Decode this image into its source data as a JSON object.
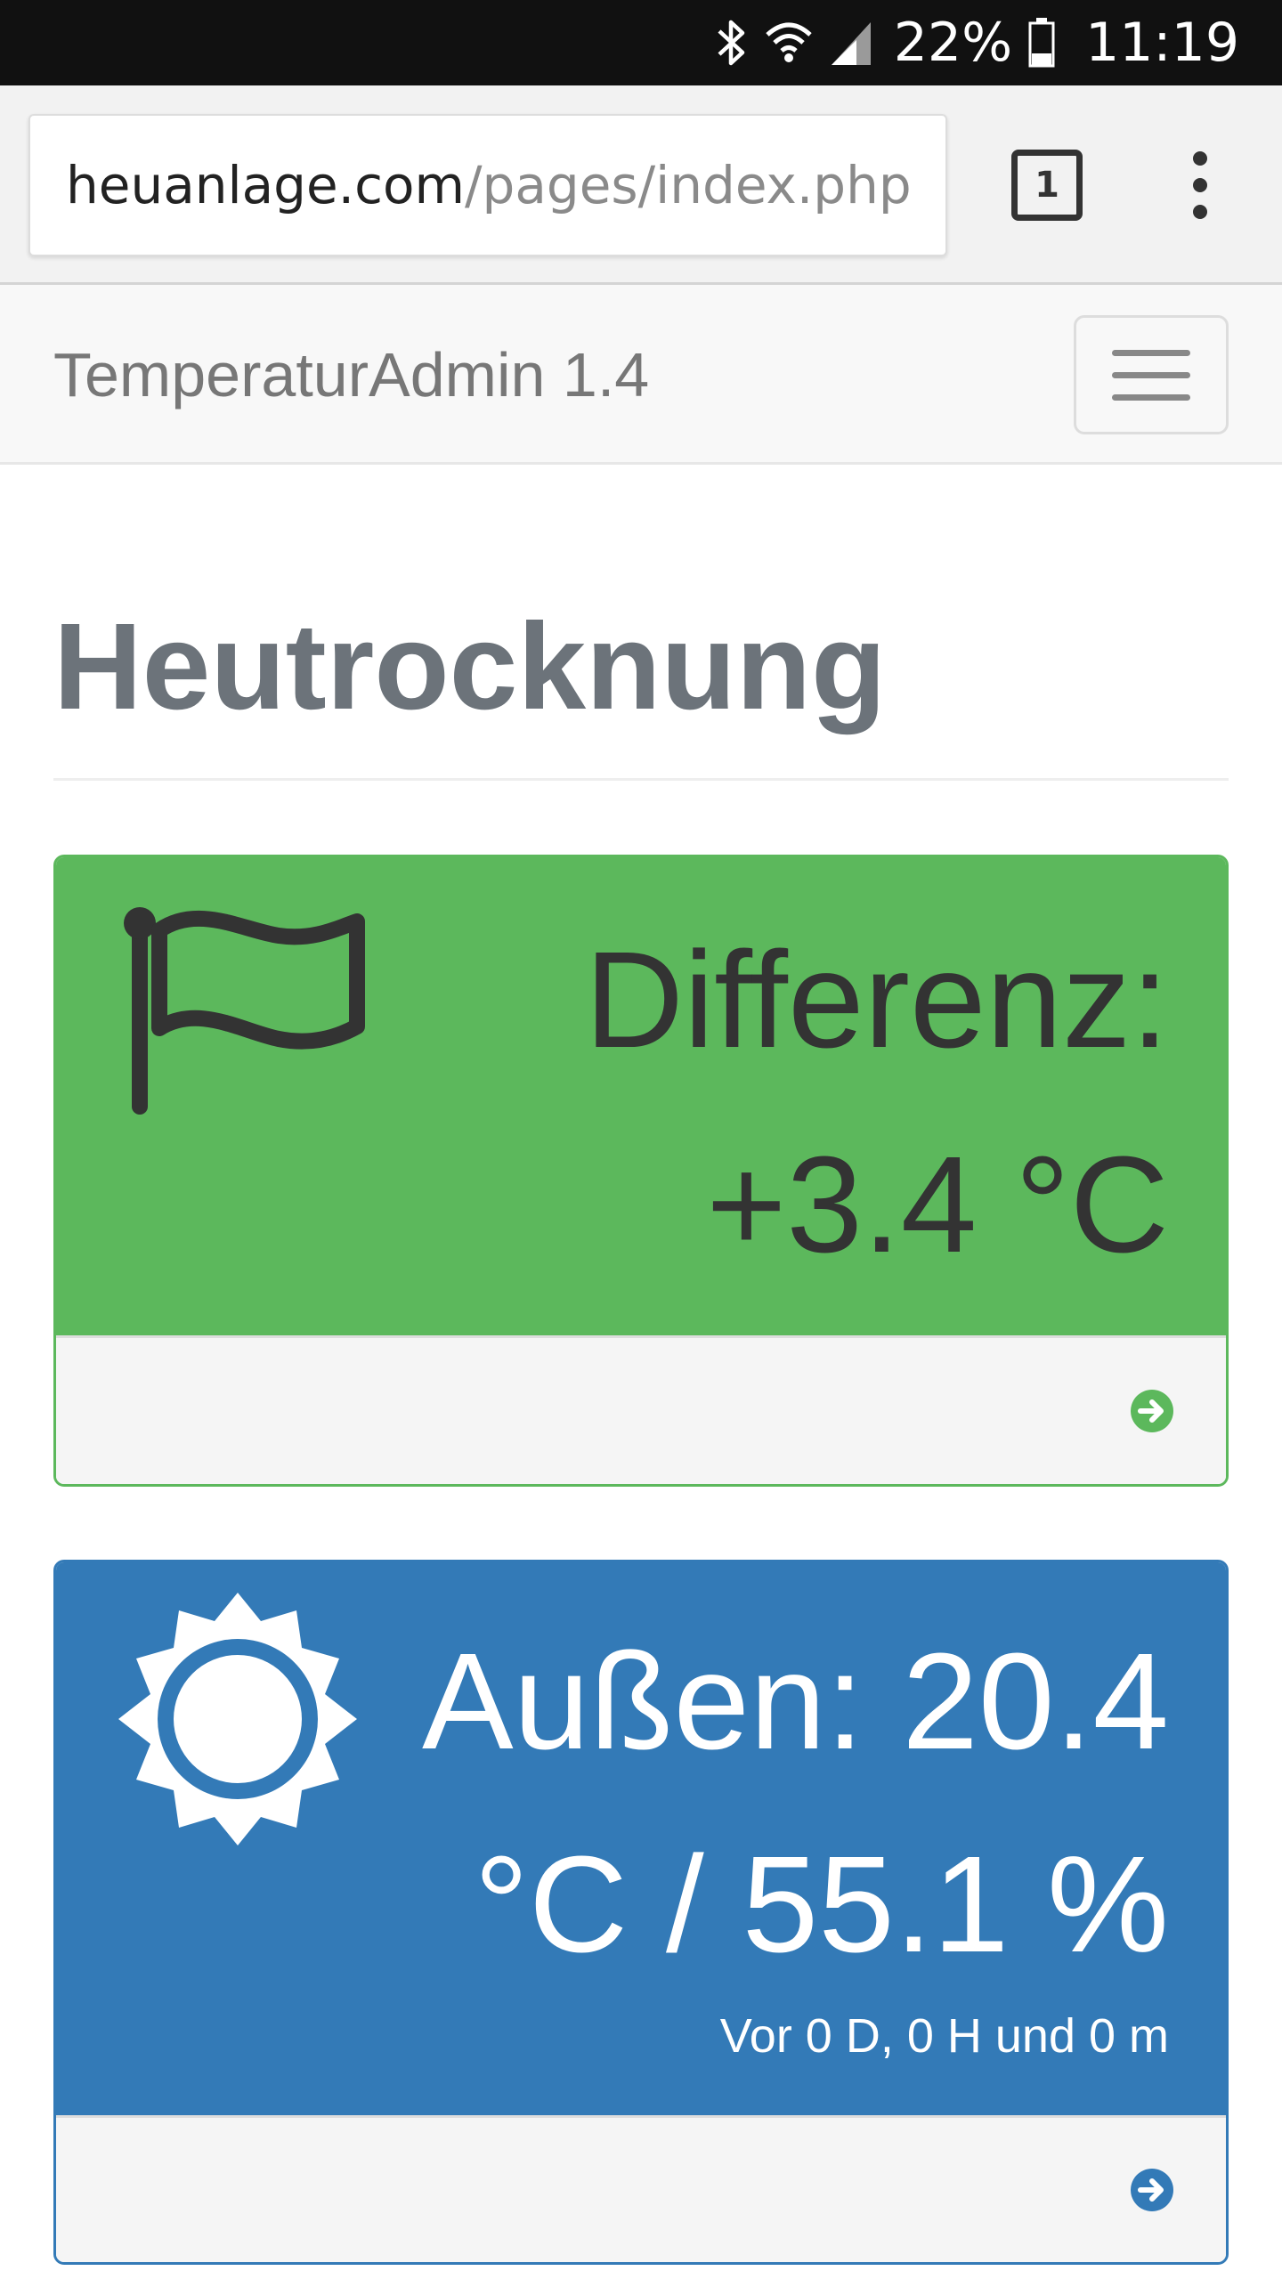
{
  "status_bar": {
    "battery": "22%",
    "time": "11:19",
    "icons": [
      "bluetooth-icon",
      "wifi-icon",
      "signal-icon",
      "battery-icon"
    ]
  },
  "browser": {
    "url_host": "heuanlage.com",
    "url_path": "/pages/index.php",
    "tab_count": "1"
  },
  "navbar": {
    "brand": "TemperaturAdmin 1.4"
  },
  "page": {
    "title": "Heutrocknung"
  },
  "panels": [
    {
      "icon": "flag-icon",
      "line1": "Differenz:",
      "line2": "+3.4 °C",
      "color": "#5cb85c"
    },
    {
      "icon": "sun-icon",
      "line1": "Außen: 20.4",
      "line2": "°C / 55.1 %",
      "note": "Vor 0 D, 0 H und 0 m",
      "color": "#337ab7"
    }
  ]
}
